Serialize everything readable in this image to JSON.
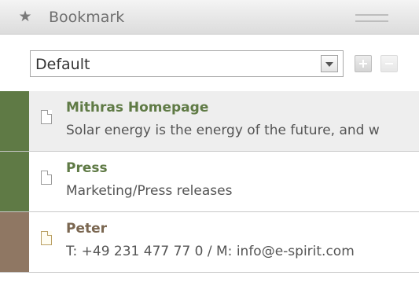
{
  "panel": {
    "title": "Bookmark",
    "icon": "star-icon"
  },
  "toolbar": {
    "selected_list": "Default",
    "add_icon": "plus-icon",
    "remove_icon": "minus-icon"
  },
  "colors": {
    "green_marker": "#5f7a45",
    "brown_marker": "#8f7763",
    "title_green": "#5f7a45",
    "title_brown": "#7a6650"
  },
  "bookmarks": [
    {
      "name": "Mithras Homepage",
      "description": "Solar energy is the energy of the future, and w",
      "marker": "green",
      "selected": true
    },
    {
      "name": "Press",
      "description": "Marketing/Press releases",
      "marker": "green",
      "selected": false
    },
    {
      "name": "Peter",
      "description": "T: +49 231 477 77 0 / M: info@e-spirit.com",
      "marker": "brown",
      "selected": false
    }
  ]
}
